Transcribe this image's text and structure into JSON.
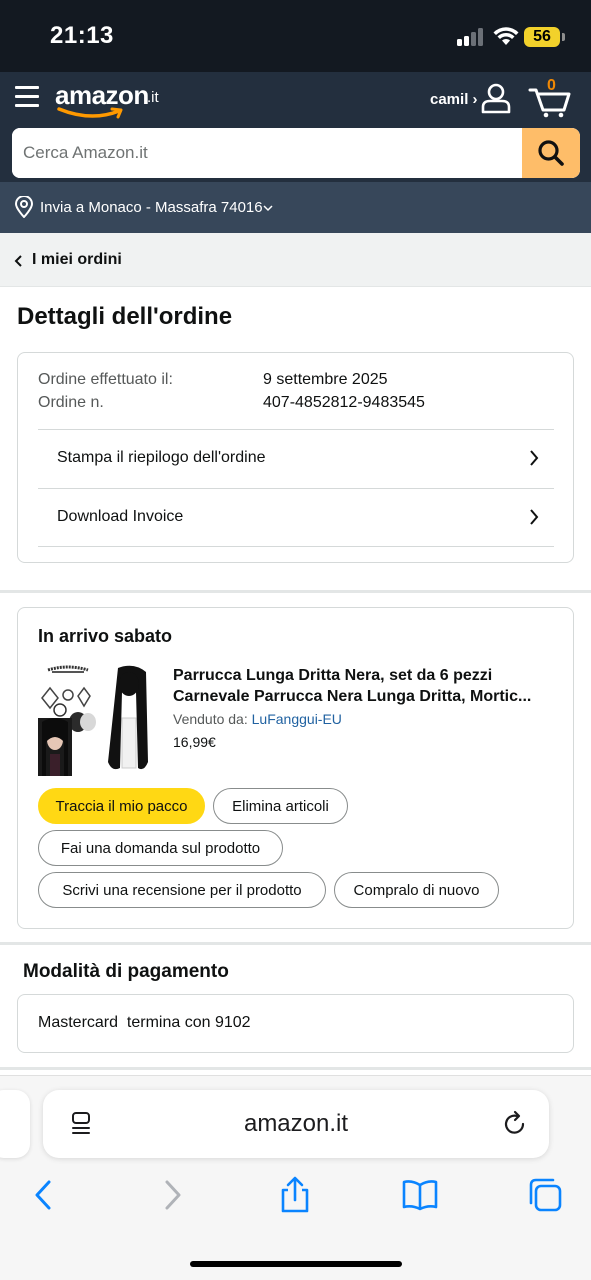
{
  "status_bar": {
    "time": "21:13",
    "battery": "56"
  },
  "header": {
    "logo": "amazon",
    "logo_tld": ".it",
    "account": "camil ›",
    "cart_count": "0",
    "search_placeholder": "Cerca Amazon.it"
  },
  "deliver": {
    "text": "Invia a Monaco - Massafra 74016"
  },
  "breadcrumb": {
    "label": "I miei ordini"
  },
  "page": {
    "title": "Dettagli dell'ordine"
  },
  "order": {
    "placed_label": "Ordine effettuato il:",
    "placed_value": "9 settembre 2025",
    "number_label": "Ordine n.",
    "number_value": "407-4852812-9483545",
    "print_summary": "Stampa il riepilogo dell'ordine",
    "download_invoice": "Download Invoice"
  },
  "shipment": {
    "status": "In arrivo sabato",
    "product": {
      "name_line1": "Parrucca Lunga Dritta Nera, set da 6 pezzi",
      "name_line2": "Carnevale Parrucca Nera Lunga Dritta, Mortic...",
      "sold_by_label": "Venduto da:",
      "seller": "LuFanggui-EU",
      "price": "16,99€"
    },
    "actions": {
      "track": "Traccia il mio pacco",
      "delete": "Elimina articoli",
      "ask": "Fai una domanda sul prodotto",
      "review": "Scrivi una recensione per il prodotto",
      "buy_again": "Compralo di nuovo"
    }
  },
  "payment": {
    "title": "Modalità di pagamento",
    "method": "Mastercard  termina con 9102"
  },
  "browser": {
    "url": "amazon.it"
  },
  "colors": {
    "header_bg": "#232f3e",
    "subnav_bg": "#37475a",
    "accent_orange": "#febd69",
    "primary_button": "#ffd814",
    "link": "#2162a1"
  }
}
